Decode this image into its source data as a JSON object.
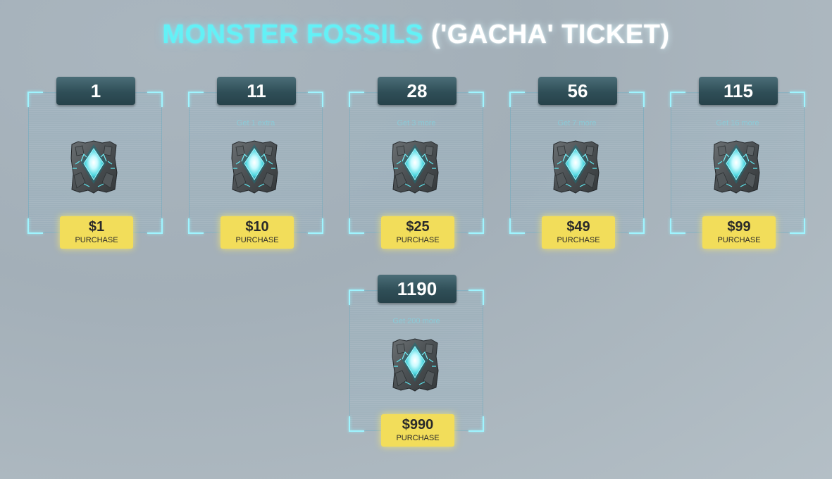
{
  "header": {
    "title_highlight": "MONSTER FOSSILS",
    "title_rest": " ('GACHA' TICKET)"
  },
  "colors": {
    "accent_cyan": "#63f1f6",
    "button_yellow": "#f2dd5a",
    "badge_teal": "#2f4e57"
  },
  "packs": [
    {
      "quantity": "1",
      "subtitle": "",
      "price": "$1",
      "action_label": "PURCHASE",
      "icon": "monster-fossil-icon"
    },
    {
      "quantity": "11",
      "subtitle": "Get 1 extra",
      "price": "$10",
      "action_label": "PURCHASE",
      "icon": "monster-fossil-icon"
    },
    {
      "quantity": "28",
      "subtitle": "Get 3 more",
      "price": "$25",
      "action_label": "PURCHASE",
      "icon": "monster-fossil-icon"
    },
    {
      "quantity": "56",
      "subtitle": "Get 7 more",
      "price": "$49",
      "action_label": "PURCHASE",
      "icon": "monster-fossil-icon"
    },
    {
      "quantity": "115",
      "subtitle": "Get 16 more",
      "price": "$99",
      "action_label": "PURCHASE",
      "icon": "monster-fossil-icon"
    },
    {
      "quantity": "1190",
      "subtitle": "Get 200 more",
      "price": "$990",
      "action_label": "PURCHASE",
      "icon": "monster-fossil-icon"
    }
  ]
}
